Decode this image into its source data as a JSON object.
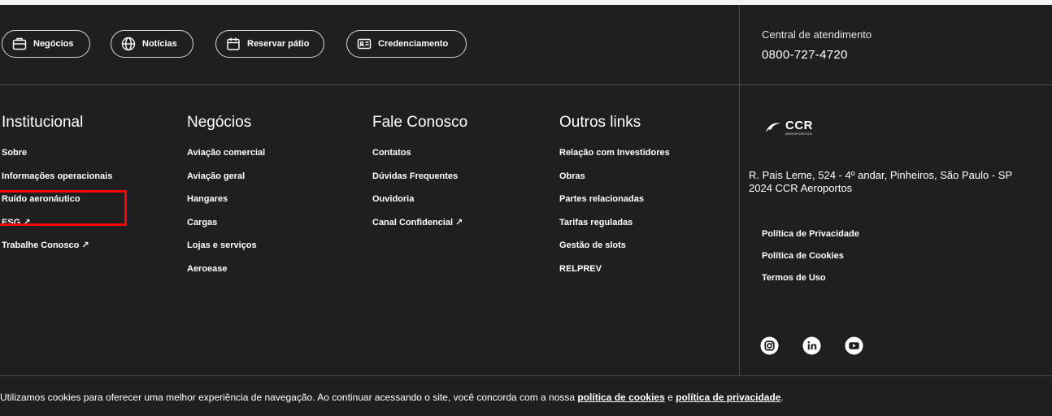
{
  "top_buttons": {
    "negocios": "Negócios",
    "noticias": "Notícias",
    "reservar": "Reservar pátio",
    "credenciamento": "Credenciamento"
  },
  "central": {
    "label": "Central de atendimento",
    "phone": "0800-727-4720"
  },
  "columns": {
    "institucional": {
      "title": "Institucional",
      "items": [
        "Sobre",
        "Informações operacionais",
        "Ruído aeronáutico",
        "ESG",
        "Trabalhe Conosco"
      ]
    },
    "negocios": {
      "title": "Negócios",
      "items": [
        "Aviação comercial",
        "Aviação geral",
        "Hangares",
        "Cargas",
        "Lojas e serviços",
        "Aeroease"
      ]
    },
    "fale": {
      "title": "Fale Conosco",
      "items": [
        "Contatos",
        "Dúvidas Frequentes",
        "Ouvidoria",
        "Canal Confidencial"
      ]
    },
    "outros": {
      "title": "Outros links",
      "items": [
        "Relação com Investidores",
        "Obras",
        "Partes relacionadas",
        "Tarifas reguladas",
        "Gestão de slots",
        "RELPREV"
      ]
    }
  },
  "external_arrow": "↗",
  "logo": {
    "name": "CCR",
    "sub": "AEROPORTOS"
  },
  "address": {
    "line1": "R. Pais Leme, 524 - 4º andar, Pinheiros, São Paulo - SP",
    "line2": "2024  CCR Aeroportos"
  },
  "policies": [
    "Política de Privacidade",
    "Política de Cookies",
    "Termos de Uso"
  ],
  "social_icons": [
    "instagram-icon",
    "linkedin-icon",
    "youtube-icon"
  ],
  "cookie": {
    "text": "Utilizamos cookies para oferecer uma melhor experiência de navegação. Ao continuar acessando o site, você concorda com a nossa ",
    "link1": "política de cookies",
    "and": " e ",
    "link2": "política de privacidade",
    "end": "."
  },
  "colors": {
    "background": "#1f1f1f",
    "highlight": "#ff0000",
    "divider": "#4b4b4b"
  }
}
